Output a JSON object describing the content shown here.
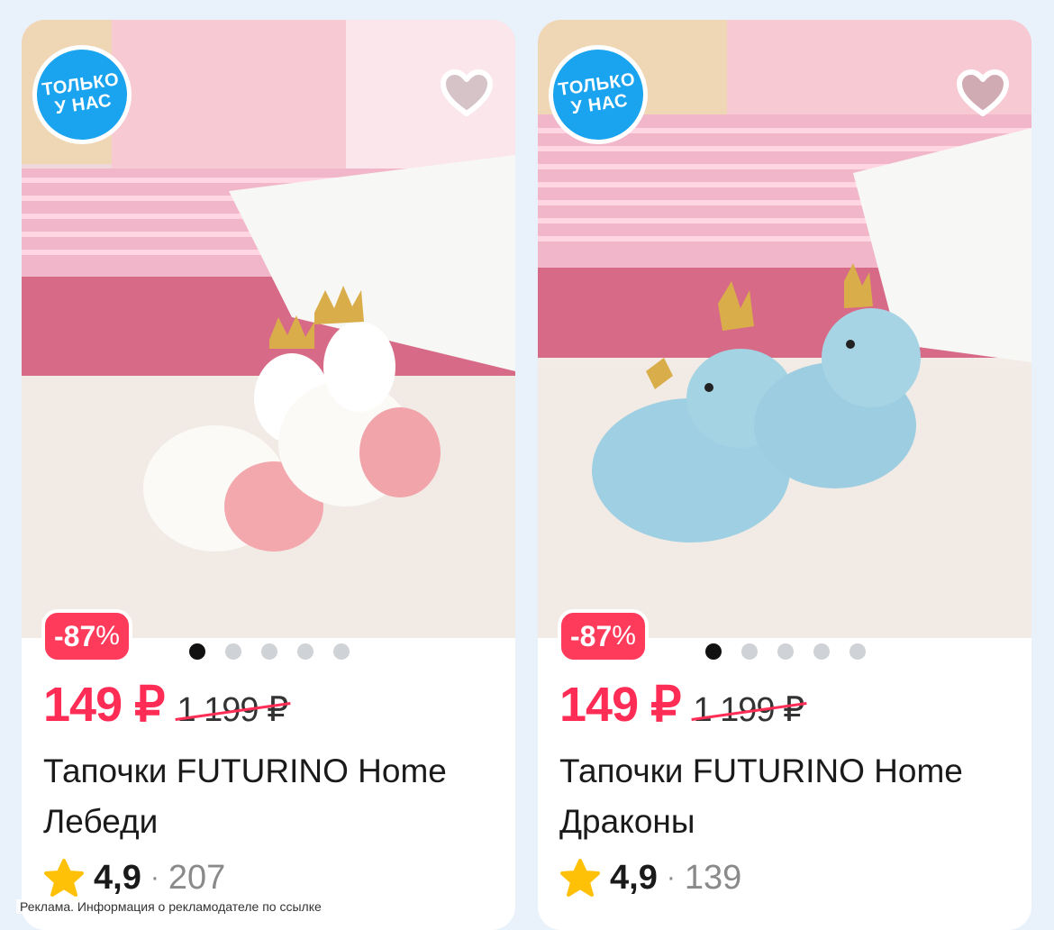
{
  "products": [
    {
      "badge_line1": "ТОЛЬКО",
      "badge_line2": "У НАС",
      "discount_num": "-87",
      "discount_pct": "%",
      "price": "149 ₽",
      "old_price": "1 199 ₽",
      "title": "Тапочки FUTURINO Home Лебеди",
      "rating": "4,9",
      "separator": "·",
      "reviews": "207",
      "image": "swan slippers"
    },
    {
      "badge_line1": "ТОЛЬКО",
      "badge_line2": "У НАС",
      "discount_num": "-87",
      "discount_pct": "%",
      "price": "149 ₽",
      "old_price": "1 199 ₽",
      "title": "Тапочки FUTURINO Home Драконы",
      "rating": "4,9",
      "separator": "·",
      "reviews": "139",
      "image": "dragon slippers"
    }
  ],
  "carousel": {
    "count": 5,
    "active": 0
  },
  "ad_note": "Реклама. Информация о рекламодателе по ссылке",
  "icons": [
    "heart-icon",
    "star-icon"
  ],
  "colors": {
    "accent": "#ff2d55",
    "badge_blue": "#1aa3ee",
    "star": "#ffc107"
  }
}
